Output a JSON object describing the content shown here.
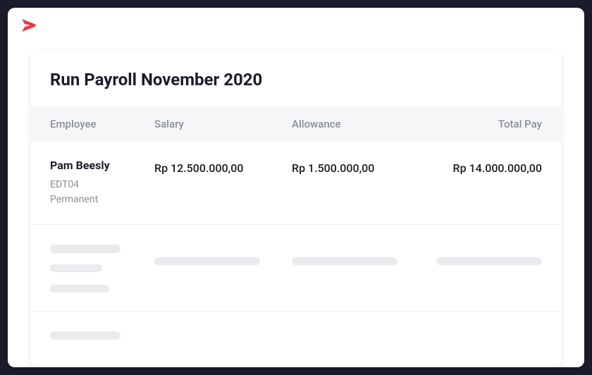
{
  "header": {
    "logo_name": "brand-logo"
  },
  "page": {
    "title": "Run Payroll November 2020"
  },
  "table": {
    "headers": {
      "employee": "Employee",
      "salary": "Salary",
      "allowance": "Allowance",
      "total_pay": "Total Pay"
    },
    "rows": [
      {
        "name": "Pam Beesly",
        "id": "EDT04",
        "type": "Permanent",
        "salary": "Rp 12.500.000,00",
        "allowance": "Rp 1.500.000,00",
        "total_pay": "Rp 14.000.000,00"
      }
    ]
  },
  "colors": {
    "brand": "#e53946",
    "text_primary": "#1a1d29",
    "text_muted": "#8a8f99",
    "bg_muted": "#f5f6f8",
    "skeleton": "#e9ebee"
  }
}
